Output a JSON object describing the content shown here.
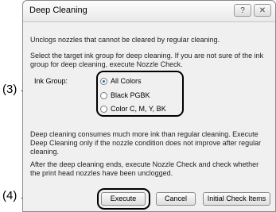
{
  "window": {
    "title": "Deep Cleaning",
    "help_label": "?",
    "close_label": "✕"
  },
  "description": "Unclogs nozzles that cannot be cleared by regular cleaning.",
  "instruction": "Select the target ink group for deep cleaning. If you are not sure of the ink group for deep cleaning, execute Nozzle Check.",
  "ink_group": {
    "label": "Ink Group:",
    "options": [
      "All Colors",
      "Black  PGBK",
      "Color  C, M, Y, BK"
    ],
    "selected": "All Colors"
  },
  "note1": "Deep cleaning consumes much more ink than regular cleaning. Execute Deep Cleaning only if the nozzle condition does not improve after regular cleaning.",
  "note2": "After the deep cleaning ends, execute Nozzle Check and check whether the print head nozzles have been unclogged.",
  "buttons": {
    "execute": "Execute",
    "cancel": "Cancel",
    "initial": "Initial Check Items"
  },
  "callouts": {
    "c3": "(3)",
    "c4": "(4)"
  }
}
